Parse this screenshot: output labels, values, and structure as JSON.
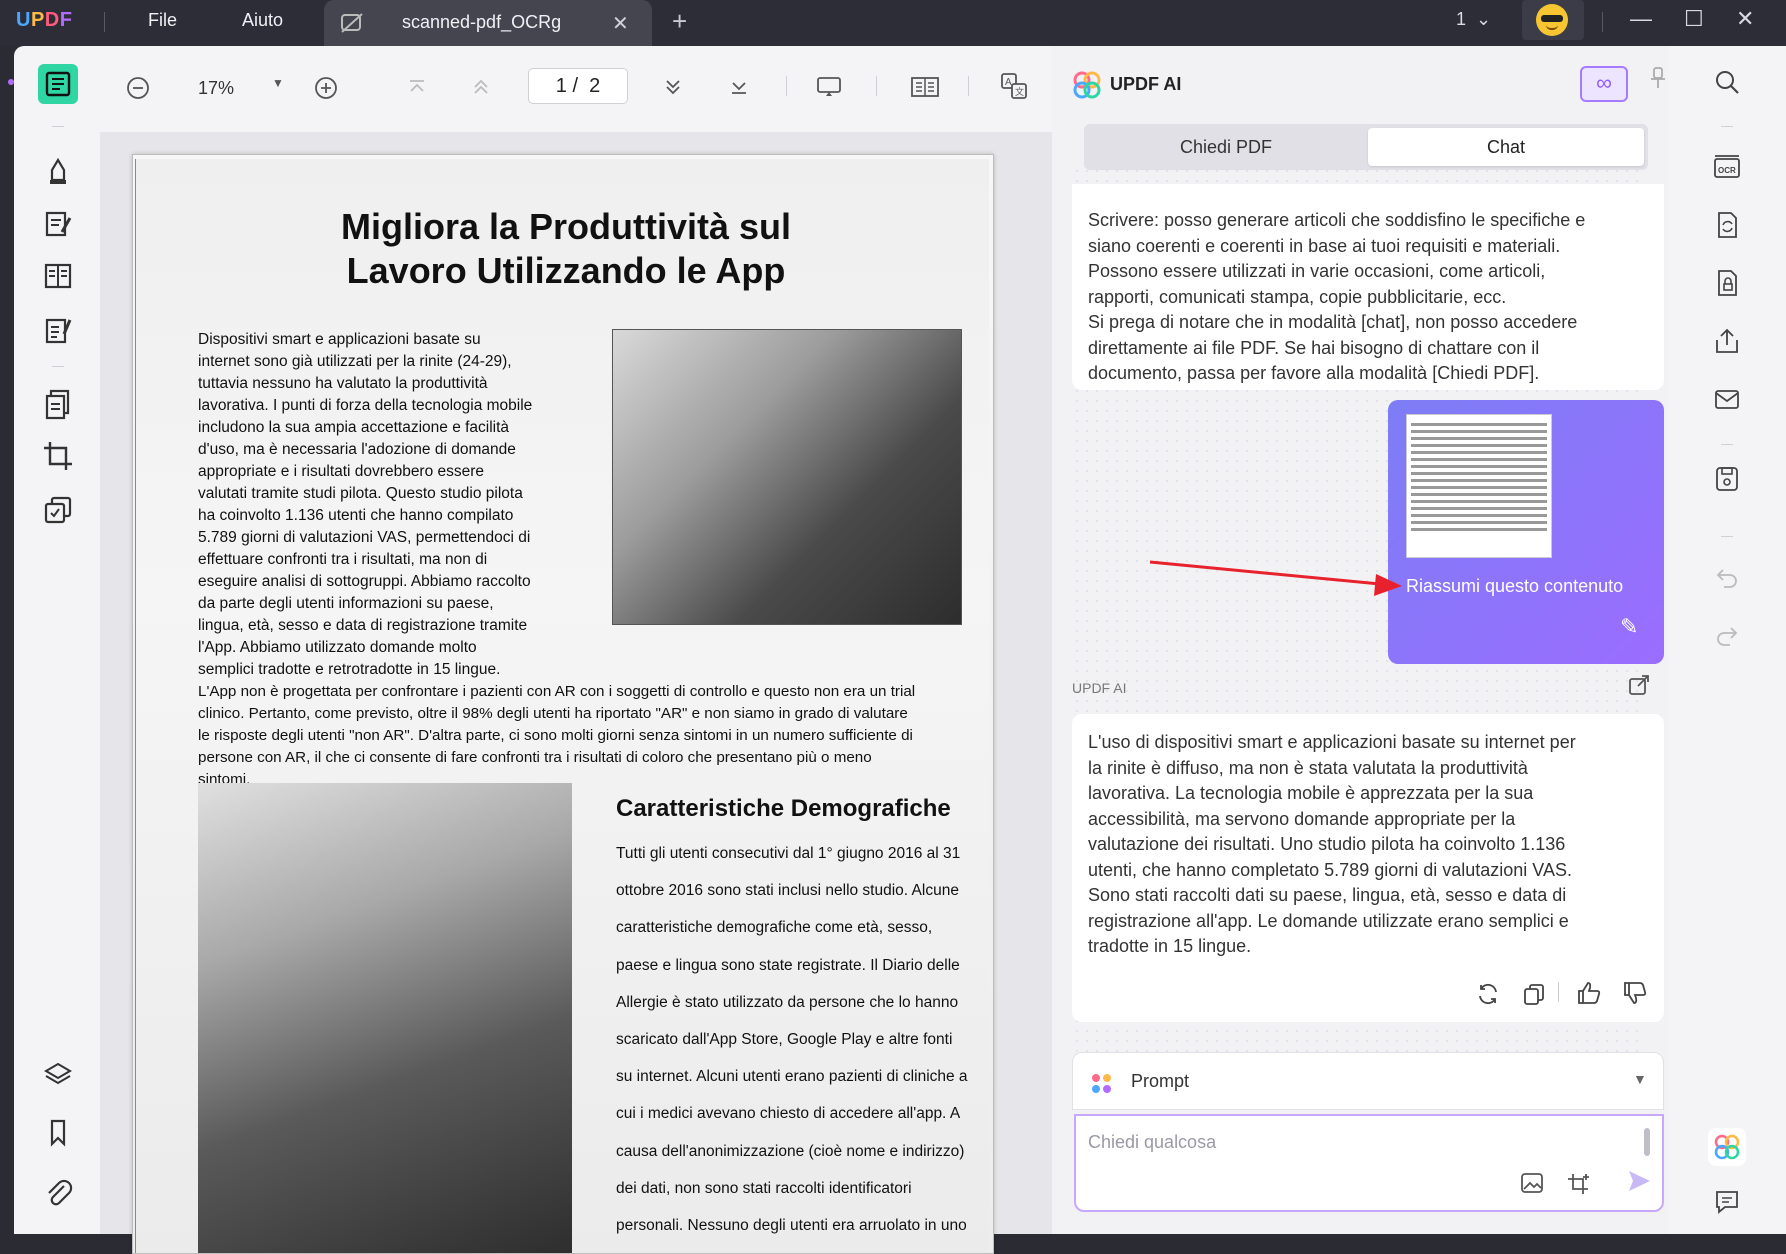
{
  "app": {
    "logo": "UPDF",
    "menu": [
      "File",
      "Aiuto"
    ],
    "tab_title": "scanned-pdf_OCRg",
    "page_selector": "1"
  },
  "toolbar": {
    "zoom": "17%",
    "page_current": "1",
    "page_total": "2",
    "page_sep": "/"
  },
  "document": {
    "title_line1": "Migliora la Produttività sul",
    "title_line2": "Lavoro Utilizzando le App",
    "intro_lines": [
      "Dispositivi smart e applicazioni basate su",
      "internet sono già utilizzati per la rinite (24-29),",
      "tuttavia nessuno ha valutato la produttività",
      "lavorativa. I punti di forza della tecnologia mobile",
      "includono la sua ampia accettazione e facilità",
      "d'uso, ma è necessaria l'adozione di domande",
      "appropriate e i risultati dovrebbero essere",
      "valutati tramite studi pilota. Questo studio pilota",
      "ha coinvolto 1.136 utenti che hanno compilato",
      "5.789 giorni di valutazioni VAS, permettendoci di",
      "effettuare confronti tra i risultati, ma non di",
      "eseguire analisi di sottogruppi. Abbiamo raccolto",
      "da parte degli utenti informazioni su paese,",
      "lingua, età, sesso e data di registrazione tramite",
      "l'App. Abbiamo utilizzato domande molto",
      "semplici tradotte e retrotradotte in 15 lingue."
    ],
    "wide_lines": [
      "L'App non è progettata per confrontare i pazienti con AR con i soggetti di controllo e questo non era un trial",
      "clinico. Pertanto, come previsto, oltre il 98% degli utenti ha riportato \"AR\" e non siamo in grado di valutare",
      "le risposte degli utenti \"non AR\". D'altra parte, ci sono molti giorni senza sintomi in un numero sufficiente di",
      "persone con AR, il che ci consente di fare confronti tra i risultati di coloro che presentano più o meno",
      "sintomi."
    ],
    "section_title": "Caratteristiche Demografiche",
    "section_lines": [
      "Tutti gli utenti consecutivi dal 1° giugno 2016 al 31",
      "ottobre 2016 sono stati inclusi nello studio. Alcune",
      "caratteristiche demografiche come età, sesso,",
      "paese e lingua sono state registrate. Il Diario delle",
      "Allergie è stato utilizzato da persone che lo hanno",
      "scaricato dall'App Store, Google Play e altre fonti",
      "su internet. Alcuni utenti erano pazienti di cliniche a",
      "cui i medici avevano chiesto di accedere all'app. A",
      "causa dell'anonimizzazione (cioè nome e indirizzo)",
      "dei dati, non sono stati raccolti identificatori",
      "personali. Nessuno degli utenti era arruolato in uno"
    ]
  },
  "ai": {
    "title": "UPDF AI",
    "tabs": [
      "Chiedi PDF",
      "Chat"
    ],
    "infinity": "∞",
    "msg1_lines": [
      "Scrivere: posso generare articoli che soddisfino le specifiche e",
      "siano coerenti e coerenti in base ai tuoi requisiti e materiali.",
      "Possono essere utilizzati in varie occasioni, come articoli,",
      "rapporti, comunicati stampa, copie pubblicitarie, ecc.",
      "Si prega di notare che in modalità [chat], non posso accedere",
      "direttamente ai file PDF. Se hai bisogno di chattare con il",
      "documento, passa per favore alla modalità [Chiedi PDF]."
    ],
    "user_msg": "Riassumi questo contenuto",
    "responder_label": "UPDF AI",
    "response_lines": [
      "L'uso di dispositivi smart e applicazioni basate su internet per",
      "la rinite è diffuso, ma non è stata valutata la produttività",
      "lavorativa. La tecnologia mobile è apprezzata per la sua",
      "accessibilità, ma servono domande appropriate per la",
      "valutazione dei risultati. Uno studio pilota ha coinvolto 1.136",
      "utenti, che hanno completato 5.789 giorni di valutazioni VAS.",
      "Sono stati raccolti dati su paese, lingua, età, sesso e data di",
      "registrazione all'app. Le domande utilizzate erano semplici e",
      "tradotte in 15 lingue."
    ],
    "prompt_label": "Prompt",
    "input_placeholder": "Chiedi qualcosa"
  },
  "colors": {
    "accent": "#8f5cff",
    "active_tool": "#2fd6a4",
    "titlebar": "#2d2d37",
    "arrow": "#e8222d"
  }
}
